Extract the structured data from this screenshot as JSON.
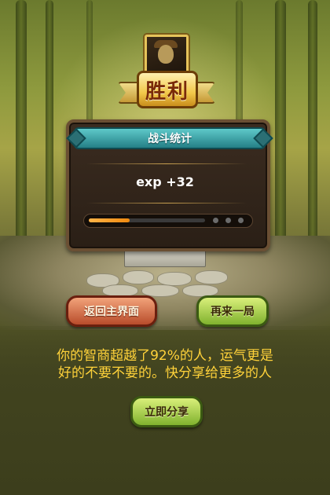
{
  "result": {
    "title": "胜利"
  },
  "stats_panel": {
    "title": "战斗统计",
    "exp_text": "exp +32",
    "progress_fraction": 0.35
  },
  "buttons": {
    "home": "返回主界面",
    "again": "再来一局",
    "share": "立即分享"
  },
  "message": {
    "line1": "你的智商超越了92%的人，运气更是",
    "line2": "好的不要不要的。快分享给更多的人"
  },
  "colors": {
    "message_text": "#ffd23a",
    "title_bar": "#3fa7ac",
    "progress_fill": "#f08a10"
  }
}
